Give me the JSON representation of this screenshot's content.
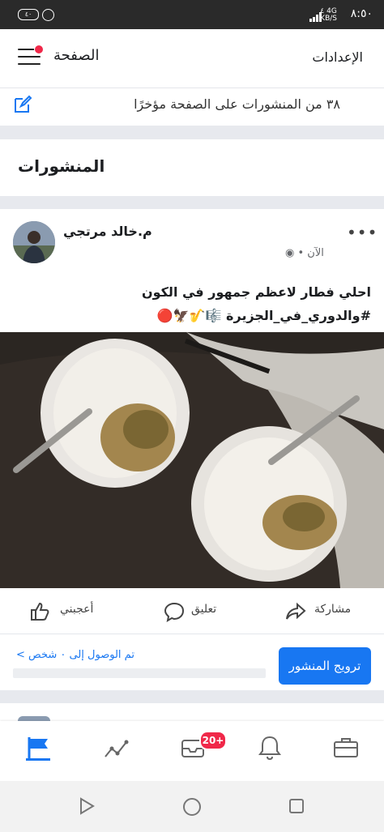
{
  "status_bar": {
    "time": "٨:٥٠",
    "network_type": "4G",
    "speed": "٤",
    "speed_unit": "KB/S",
    "battery": "٤٠"
  },
  "header": {
    "title": "الصفحة",
    "settings_label": "الإعدادات",
    "notification_dot_color": "#f02849"
  },
  "stats": {
    "text": "٣٨ من المنشورات على الصفحة مؤخرًا"
  },
  "section": {
    "title": "المنشورات"
  },
  "post": {
    "author": "م.خالد مرتجي",
    "time": "الآن",
    "text_line1": "احلي فطار لاعظم جمهور في الكون",
    "text_line2": "#والدوري_في_الجزيرة 🎼🎷🦅🔴",
    "actions": {
      "like": "أعجبني",
      "comment": "تعليق",
      "share": "مشاركة"
    },
    "reach_text": "تم الوصول إلى ٠ شخص",
    "boost_label": "ترويج المنشور"
  },
  "bottom_nav": {
    "notifications_badge": "20+"
  },
  "colors": {
    "accent": "#1877f2",
    "badge": "#f02849"
  }
}
